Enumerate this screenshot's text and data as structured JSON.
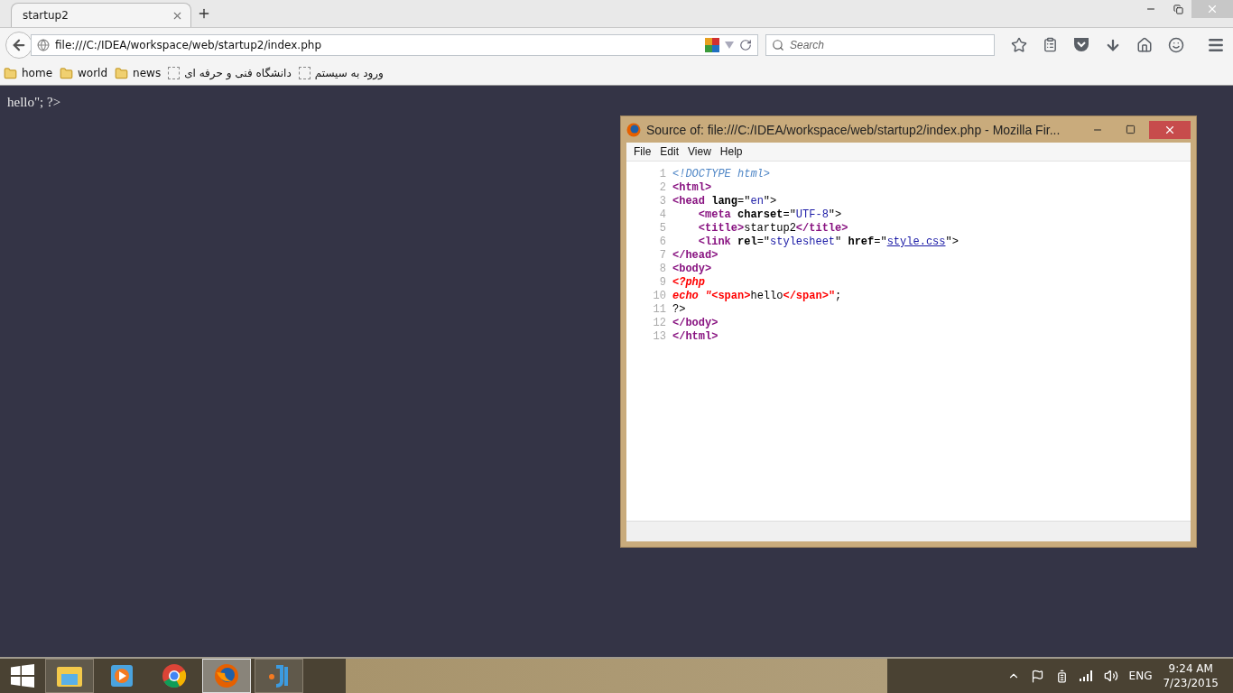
{
  "browser": {
    "tabs": [
      {
        "label": "startup2",
        "selected": true
      }
    ],
    "address": "file:///C:/IDEA/workspace/web/startup2/index.php",
    "search": {
      "placeholder": "Search"
    },
    "bookmarks": [
      {
        "kind": "folder",
        "label": "home"
      },
      {
        "kind": "folder",
        "label": "world"
      },
      {
        "kind": "folder",
        "label": "news"
      },
      {
        "kind": "page",
        "label": "دانشگاه فنی و حرفه ای"
      },
      {
        "kind": "page",
        "label": "ورود به سیستم"
      }
    ]
  },
  "page_text": "hello\"; ?>",
  "source_window": {
    "title": "Source of: file:///C:/IDEA/workspace/web/startup2/index.php - Mozilla Fir...",
    "menu": [
      "File",
      "Edit",
      "View",
      "Help"
    ],
    "lines": [
      {
        "number": "1",
        "tokens": [
          {
            "kind": "doctype",
            "text": "<!DOCTYPE html>"
          }
        ]
      },
      {
        "number": "2",
        "tokens": [
          {
            "kind": "tag",
            "text": "<html>"
          }
        ]
      },
      {
        "number": "3",
        "tokens": [
          {
            "kind": "tag",
            "text": "<head "
          },
          {
            "kind": "attr",
            "text": "lang"
          },
          {
            "kind": "text",
            "text": "=\""
          },
          {
            "kind": "value",
            "text": "en"
          },
          {
            "kind": "text",
            "text": "\">"
          }
        ]
      },
      {
        "number": "4",
        "tokens": [
          {
            "kind": "tag",
            "text": "    <meta "
          },
          {
            "kind": "attr",
            "text": "charset"
          },
          {
            "kind": "text",
            "text": "=\""
          },
          {
            "kind": "value",
            "text": "UTF-8"
          },
          {
            "kind": "text",
            "text": "\">"
          }
        ]
      },
      {
        "number": "5",
        "tokens": [
          {
            "kind": "tag",
            "text": "    <title>"
          },
          {
            "kind": "text",
            "text": "startup2"
          },
          {
            "kind": "tag",
            "text": "</title>"
          }
        ]
      },
      {
        "number": "6",
        "tokens": [
          {
            "kind": "tag",
            "text": "    <link "
          },
          {
            "kind": "attr",
            "text": "rel"
          },
          {
            "kind": "text",
            "text": "=\""
          },
          {
            "kind": "value",
            "text": "stylesheet"
          },
          {
            "kind": "text",
            "text": "\" "
          },
          {
            "kind": "attr",
            "text": "href"
          },
          {
            "kind": "text",
            "text": "=\""
          },
          {
            "kind": "link",
            "text": "style.css"
          },
          {
            "kind": "text",
            "text": "\">"
          }
        ]
      },
      {
        "number": "7",
        "tokens": [
          {
            "kind": "tag",
            "text": "</head>"
          }
        ]
      },
      {
        "number": "8",
        "tokens": [
          {
            "kind": "tag",
            "text": "<body>"
          }
        ]
      },
      {
        "number": "9",
        "tokens": [
          {
            "kind": "php",
            "text": "<?php"
          }
        ]
      },
      {
        "number": "10",
        "tokens": [
          {
            "kind": "php",
            "text": "echo \""
          },
          {
            "kind": "phptag",
            "text": "<span>"
          },
          {
            "kind": "text",
            "text": "hello"
          },
          {
            "kind": "phptag",
            "text": "</span>"
          },
          {
            "kind": "phptag",
            "text": "\""
          },
          {
            "kind": "text",
            "text": ";"
          }
        ]
      },
      {
        "number": "11",
        "tokens": [
          {
            "kind": "text",
            "text": "?>"
          }
        ]
      },
      {
        "number": "12",
        "tokens": [
          {
            "kind": "tag",
            "text": "</body>"
          }
        ]
      },
      {
        "number": "13",
        "tokens": [
          {
            "kind": "tag",
            "text": "</html>"
          }
        ]
      }
    ]
  },
  "taskbar": {
    "apps": [
      {
        "kind": "explorer",
        "running": true,
        "selected": false
      },
      {
        "kind": "media",
        "running": false,
        "selected": false
      },
      {
        "kind": "chrome",
        "running": false,
        "selected": false
      },
      {
        "kind": "firefox",
        "running": true,
        "selected": true
      },
      {
        "kind": "ide",
        "running": true,
        "selected": false
      }
    ],
    "language": "ENG",
    "time": "9:24 AM",
    "date": "7/23/2015"
  }
}
